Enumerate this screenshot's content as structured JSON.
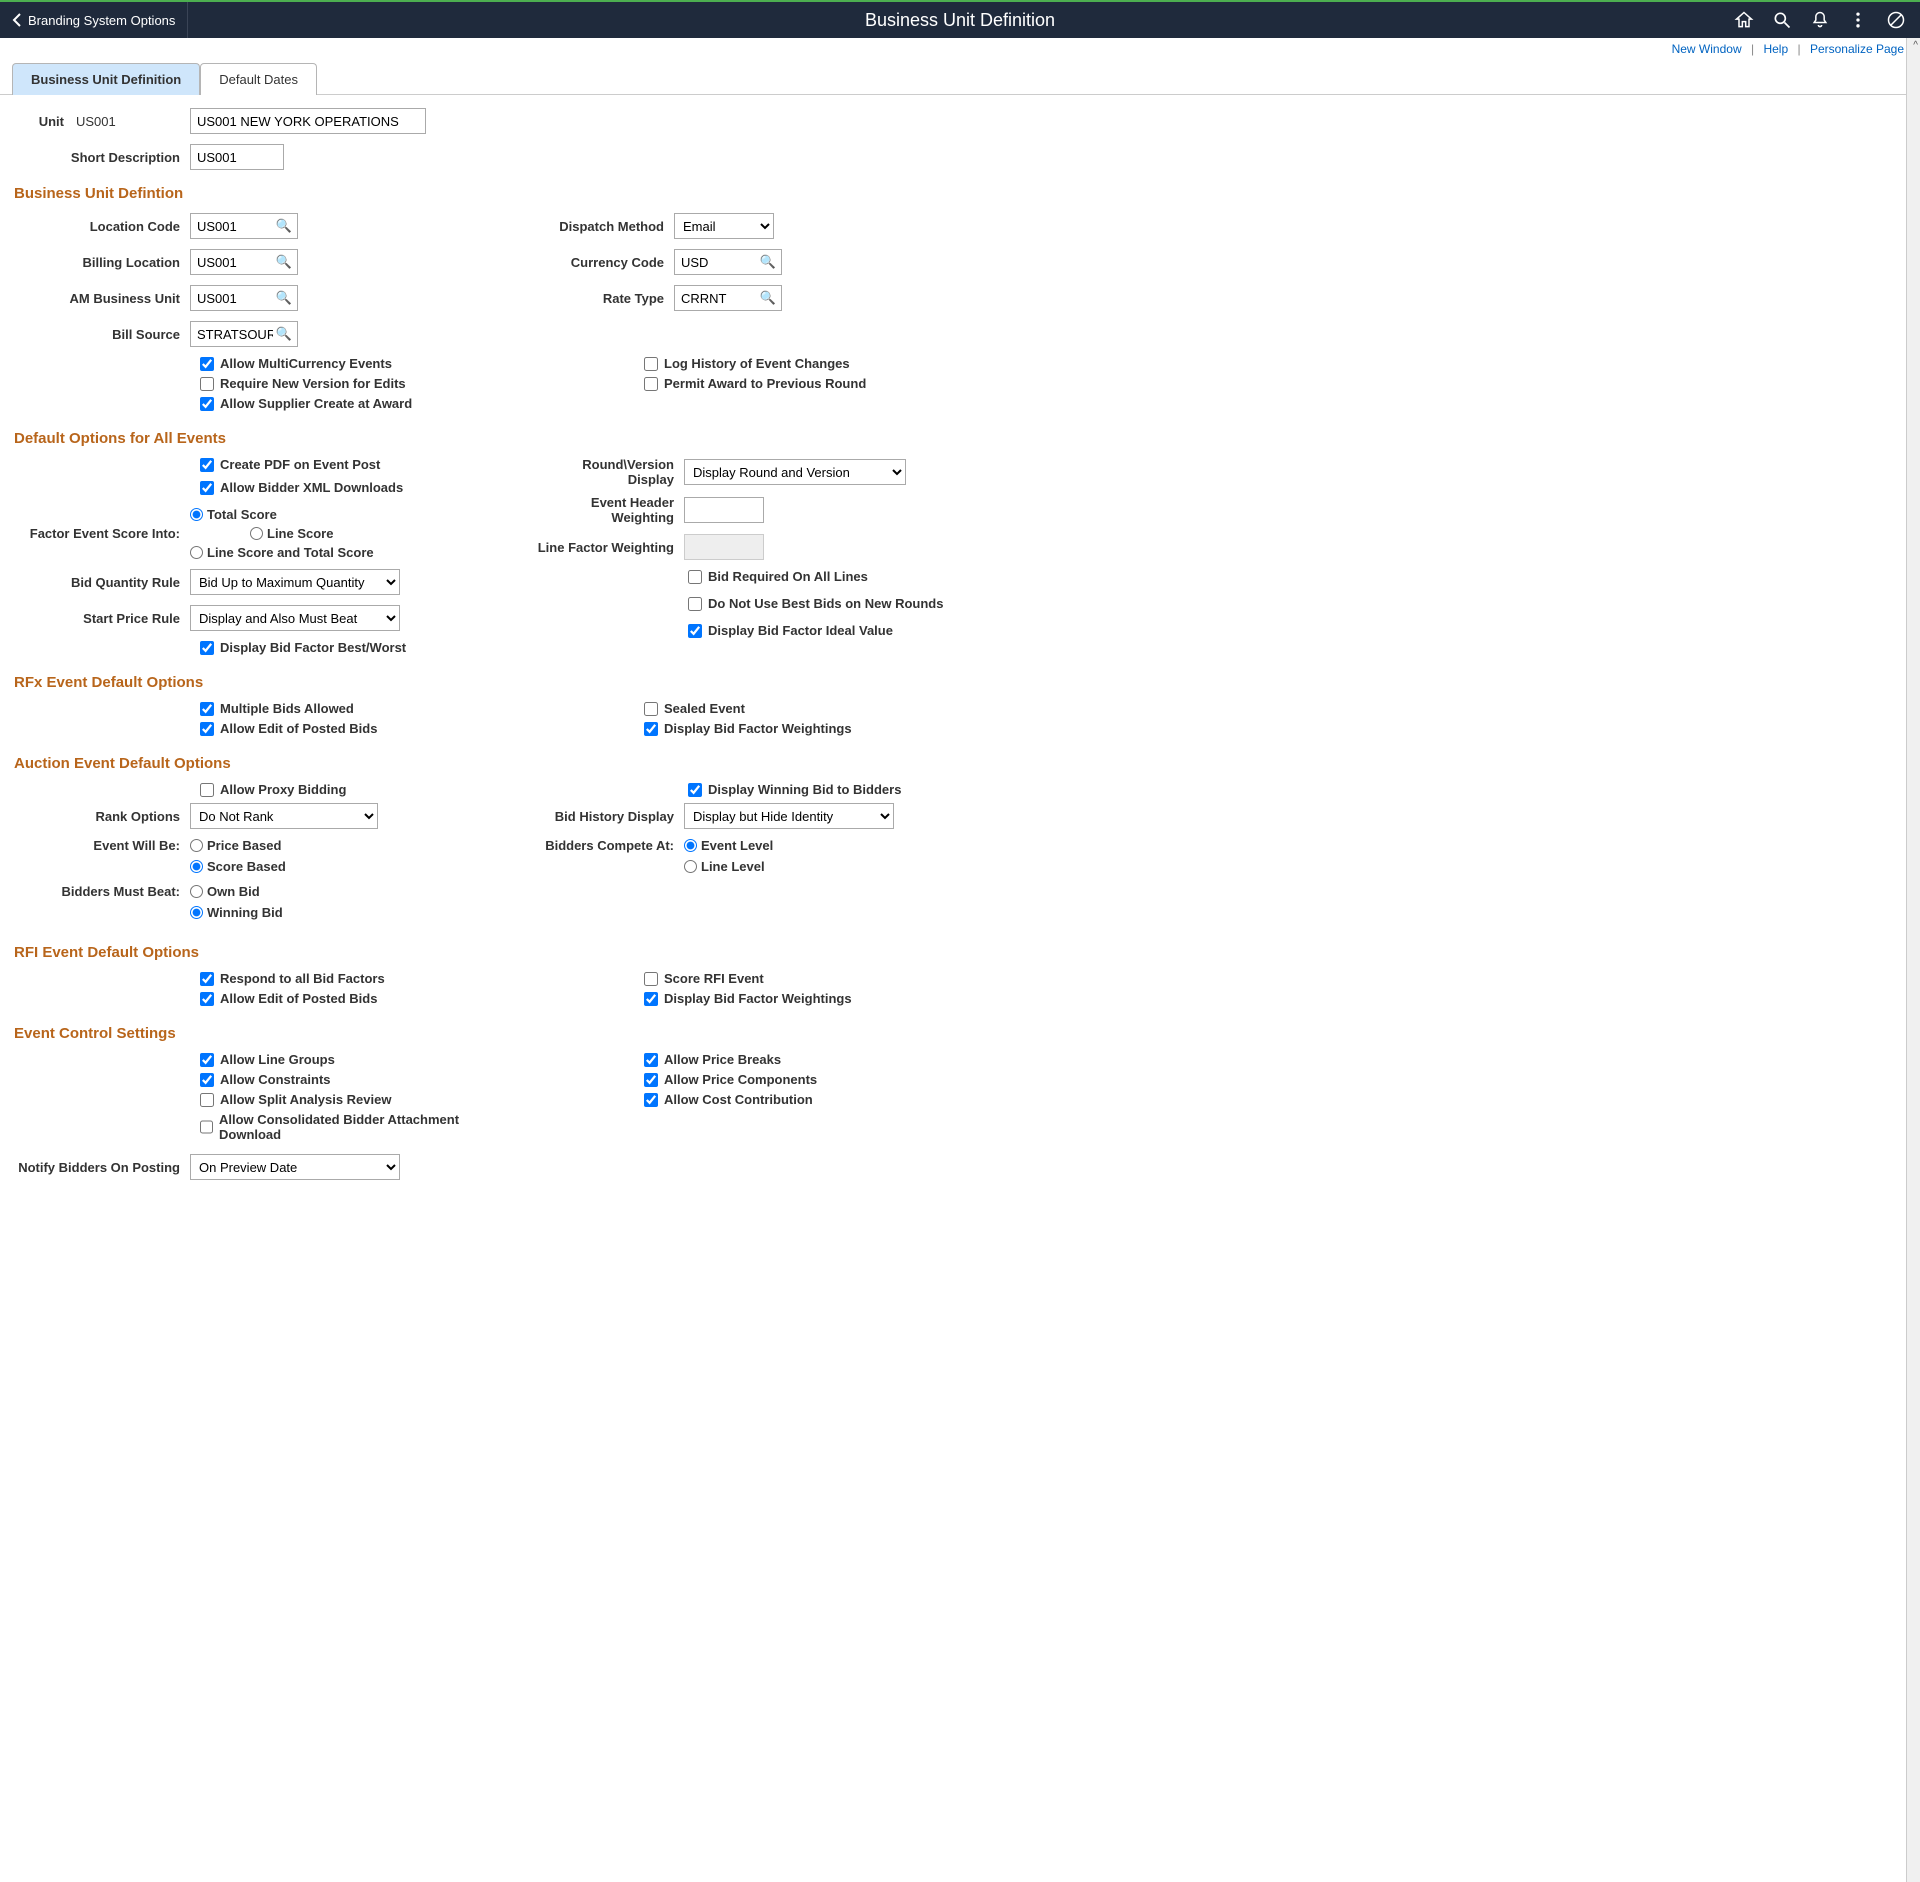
{
  "header": {
    "back_label": "Branding System Options",
    "title": "Business Unit Definition"
  },
  "top_links": {
    "new_window": "New Window",
    "help": "Help",
    "personalize": "Personalize Page"
  },
  "tabs": {
    "active": "Business Unit Definition",
    "other": "Default Dates"
  },
  "fields": {
    "unit_label": "Unit",
    "unit_value": "US001",
    "unit_desc": "US001 NEW YORK OPERATIONS",
    "short_desc_label": "Short Description",
    "short_desc_value": "US001"
  },
  "section_bud": "Business Unit Defintion",
  "bud": {
    "location_code_label": "Location Code",
    "location_code": "US001",
    "billing_location_label": "Billing Location",
    "billing_location": "US001",
    "am_bu_label": "AM Business Unit",
    "am_bu": "US001",
    "bill_source_label": "Bill Source",
    "bill_source": "STRATSOURC",
    "dispatch_method_label": "Dispatch Method",
    "dispatch_method": "Email",
    "currency_code_label": "Currency Code",
    "currency_code": "USD",
    "rate_type_label": "Rate Type",
    "rate_type": "CRRNT",
    "allow_multicurrency": "Allow MultiCurrency Events",
    "require_new_version": "Require New Version for Edits",
    "allow_supplier_create": "Allow Supplier Create at Award",
    "log_history": "Log History of Event Changes",
    "permit_award_prev": "Permit Award to Previous Round"
  },
  "section_default": "Default Options for All Events",
  "default_opts": {
    "create_pdf": "Create PDF on Event Post",
    "allow_xml": "Allow Bidder XML Downloads",
    "factor_score_label": "Factor Event Score Into:",
    "total_score": "Total Score",
    "line_score": "Line Score",
    "line_and_total": "Line Score and Total Score",
    "bid_qty_rule_label": "Bid Quantity Rule",
    "bid_qty_rule": "Bid Up to Maximum Quantity",
    "start_price_rule_label": "Start Price Rule",
    "start_price_rule": "Display and Also Must Beat",
    "display_best_worst": "Display Bid Factor Best/Worst",
    "round_display_label": "Round\\Version Display",
    "round_display": "Display Round and Version",
    "header_weight_label": "Event Header Weighting",
    "line_factor_weight_label": "Line Factor Weighting",
    "bid_required_all": "Bid Required On All Lines",
    "no_best_bids": "Do Not Use Best Bids on New Rounds",
    "display_ideal": "Display Bid Factor Ideal Value"
  },
  "section_rfx": "RFx Event Default Options",
  "rfx": {
    "multiple_bids": "Multiple Bids Allowed",
    "allow_edit_posted": "Allow Edit of Posted Bids",
    "sealed_event": "Sealed Event",
    "display_weightings": "Display Bid Factor Weightings"
  },
  "section_auction": "Auction Event Default Options",
  "auction": {
    "allow_proxy": "Allow Proxy Bidding",
    "rank_options_label": "Rank Options",
    "rank_options": "Do Not Rank",
    "event_will_be_label": "Event Will Be:",
    "price_based": "Price Based",
    "score_based": "Score Based",
    "bidders_must_beat_label": "Bidders Must Beat:",
    "own_bid": "Own Bid",
    "winning_bid": "Winning Bid",
    "display_winning": "Display Winning Bid to Bidders",
    "bid_history_label": "Bid History Display",
    "bid_history": "Display but Hide Identity",
    "bidders_compete_label": "Bidders Compete At:",
    "event_level": "Event Level",
    "line_level": "Line Level"
  },
  "section_rfi": "RFI Event Default Options",
  "rfi": {
    "respond_all": "Respond to all Bid Factors",
    "allow_edit_posted": "Allow Edit of Posted Bids",
    "score_rfi": "Score RFI Event",
    "display_weightings": "Display Bid Factor Weightings"
  },
  "section_event_ctrl": "Event Control Settings",
  "event_ctrl": {
    "allow_line_groups": "Allow Line Groups",
    "allow_constraints": "Allow Constraints",
    "allow_split_analysis": "Allow Split Analysis Review",
    "allow_consolidated": "Allow Consolidated Bidder Attachment Download",
    "allow_price_breaks": "Allow Price Breaks",
    "allow_price_components": "Allow Price Components",
    "allow_cost_contribution": "Allow Cost Contribution",
    "notify_bidders_label": "Notify Bidders On Posting",
    "notify_bidders": "On Preview Date"
  }
}
